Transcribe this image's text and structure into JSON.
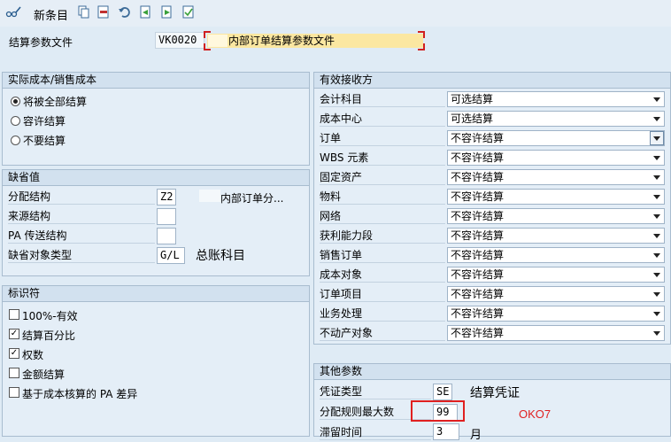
{
  "toolbar": {
    "new_entries_label": "新条目"
  },
  "header": {
    "settlement_profile_label": "结算参数文件",
    "profile_code": "VK0020",
    "profile_description": "内部订单结算参数文件"
  },
  "actual_costs": {
    "title": "实际成本/销售成本",
    "options": [
      {
        "label": "将被全部结算",
        "selected": true
      },
      {
        "label": "容许结算",
        "selected": false
      },
      {
        "label": "不要结算",
        "selected": false
      }
    ]
  },
  "defaults": {
    "title": "缺省值",
    "rows": [
      {
        "label": "分配结构",
        "value": "Z2",
        "description": "内部订单分..."
      },
      {
        "label": "来源结构",
        "value": "",
        "description": ""
      },
      {
        "label": "PA 传送结构",
        "value": "",
        "description": ""
      },
      {
        "label": "缺省对象类型",
        "value": "G/L",
        "description": "总账科目"
      }
    ]
  },
  "indicators": {
    "title": "标识符",
    "items": [
      {
        "label": "100%-有效",
        "checked": false
      },
      {
        "label": "结算百分比",
        "checked": true
      },
      {
        "label": "权数",
        "checked": true
      },
      {
        "label": "金额结算",
        "checked": false
      },
      {
        "label": "基于成本核算的 PA 差异",
        "checked": false
      }
    ]
  },
  "valid_receivers": {
    "title": "有效接收方",
    "rows": [
      {
        "label": "会计科目",
        "value": "可选结算"
      },
      {
        "label": "成本中心",
        "value": "可选结算"
      },
      {
        "label": "订单",
        "value": "不容许结算"
      },
      {
        "label": "WBS 元素",
        "value": "不容许结算"
      },
      {
        "label": "固定资产",
        "value": "不容许结算"
      },
      {
        "label": "物料",
        "value": "不容许结算"
      },
      {
        "label": "网络",
        "value": "不容许结算"
      },
      {
        "label": "获利能力段",
        "value": "不容许结算"
      },
      {
        "label": "销售订单",
        "value": "不容许结算"
      },
      {
        "label": "成本对象",
        "value": "不容许结算"
      },
      {
        "label": "订单项目",
        "value": "不容许结算"
      },
      {
        "label": "业务处理",
        "value": "不容许结算"
      },
      {
        "label": "不动产对象",
        "value": "不容许结算"
      }
    ]
  },
  "other_params": {
    "title": "其他参数",
    "document_type_label": "凭证类型",
    "document_type_value": "SE",
    "document_type_desc": "结算凭证",
    "max_rules_label": "分配规则最大数",
    "max_rules_value": "99",
    "retention_label": "滞留时间",
    "retention_value": "3",
    "retention_unit": "月"
  },
  "annotation": {
    "text": "OKO7",
    "color": "#e02020"
  }
}
